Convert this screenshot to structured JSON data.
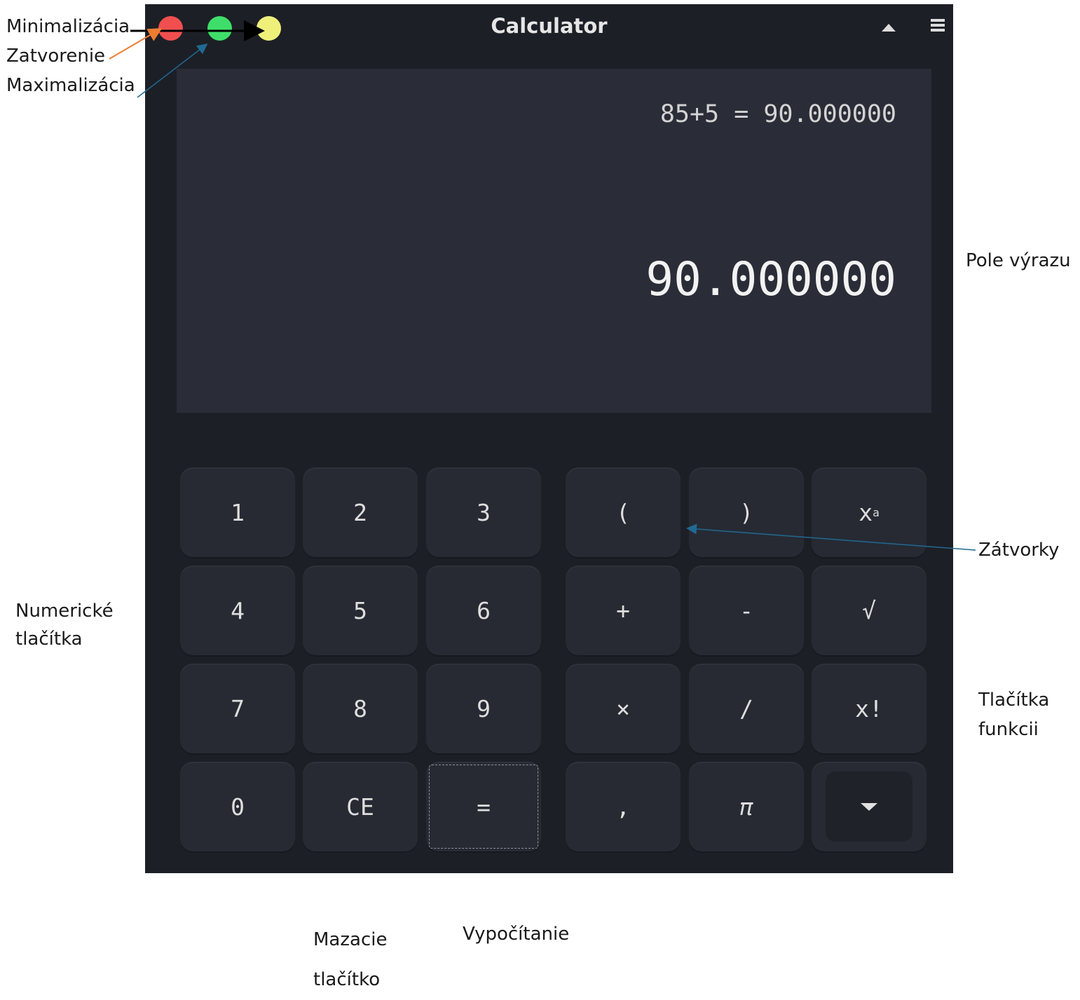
{
  "window": {
    "title": "Calculator",
    "colors": {
      "close": "#f14f4f",
      "minimize": "#3fde6a",
      "maximize": "#eef07a",
      "background": "#1d1f26",
      "display": "#2a2d37",
      "key": "#272a33"
    },
    "icons": {
      "collapse": "caret-up-icon",
      "menu": "hamburger-menu-icon",
      "more": "caret-down-icon"
    }
  },
  "display": {
    "expression": "85+5 = 90.000000",
    "result": "90.000000"
  },
  "keypad": {
    "numeric": [
      [
        "1",
        "2",
        "3"
      ],
      [
        "4",
        "5",
        "6"
      ],
      [
        "7",
        "8",
        "9"
      ],
      [
        "0",
        "CE",
        "="
      ]
    ],
    "functions": [
      [
        "(",
        ")",
        "x"
      ],
      [
        "+",
        "-",
        "√"
      ],
      [
        "×",
        "/",
        "x!"
      ],
      [
        ",",
        "π",
        ""
      ]
    ],
    "power_superscript": "a"
  },
  "annotations": {
    "minimize": "Minimalizácia",
    "close": "Zatvorenie",
    "maximize": "Maximalizácia",
    "expression_field": "Pole výrazu",
    "parentheses": "Zátvorky",
    "numeric_line1": "Numerické",
    "numeric_line2": "tlačítka",
    "function_line1": "Tlačítka",
    "function_line2": "funkcii",
    "clear_line1": "Mazacie",
    "clear_line2": "tlačítko",
    "compute": "Vypočítanie"
  }
}
